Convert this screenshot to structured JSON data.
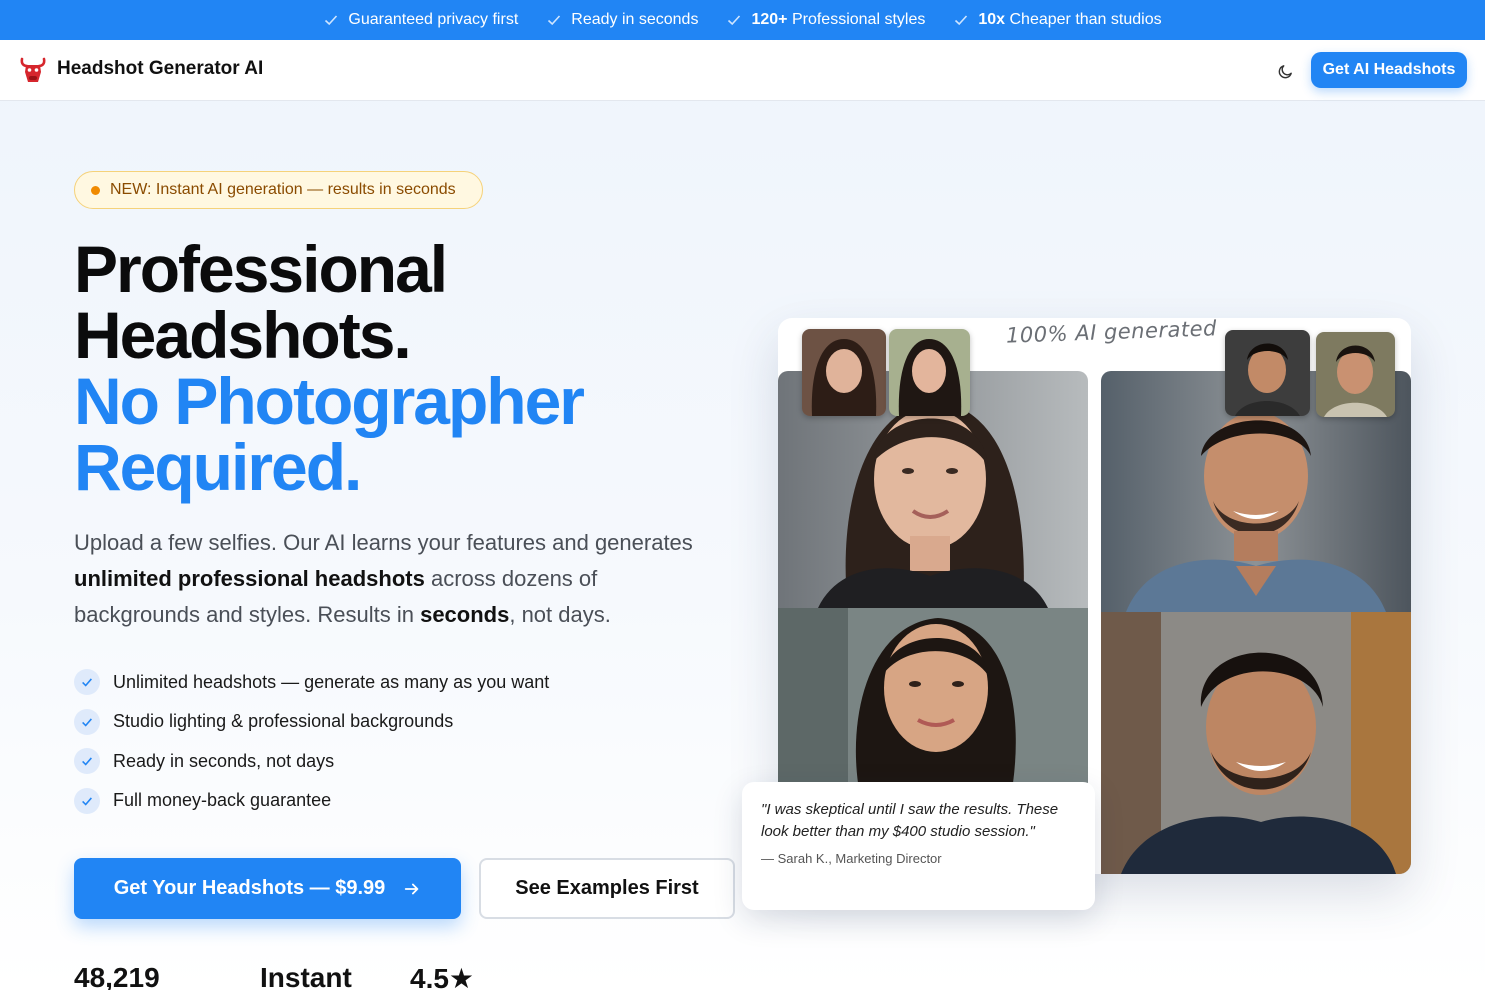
{
  "topbar": {
    "items": [
      {
        "bold": "",
        "text": "Guaranteed privacy first"
      },
      {
        "bold": "",
        "text": "Ready in seconds"
      },
      {
        "bold": "120+",
        "text": " Professional styles"
      },
      {
        "bold": "10x",
        "text": " Cheaper than studios"
      }
    ],
    "icon": "check-icon"
  },
  "navbar": {
    "brand": "Headshot Generator AI",
    "logo_icon": "bull-logo-icon",
    "theme_icon": "moon-icon",
    "cta_label": "Get AI Headshots"
  },
  "hero": {
    "badge": "NEW: Instant AI generation — results in seconds",
    "headline_dark_1": "Professional",
    "headline_dark_2": "Headshots.",
    "headline_blue_1": "No Photographer",
    "headline_blue_2": "Required.",
    "sub_1": "Upload a few selfies. Our AI learns your features and generates ",
    "sub_bold_1": "unlimited professional headshots",
    "sub_2": " across dozens of backgrounds and styles. Results in ",
    "sub_bold_2": "seconds",
    "sub_3": ", not days.",
    "features": [
      "Unlimited headshots — generate as many as you want",
      "Studio lighting & professional backgrounds",
      "Ready in seconds, not days",
      "Full money-back guarantee"
    ],
    "cta_primary": "Get Your Headshots — $9.99",
    "cta_secondary": "See Examples First",
    "stats": [
      "48,219",
      "Instant",
      "4.5★"
    ]
  },
  "gallery": {
    "label": "100% AI generated",
    "testimonial_quote": "\"I was skeptical until I saw the results. These look better than my $400 studio session.\"",
    "testimonial_author": "— Sarah K., Marketing Director"
  },
  "colors": {
    "accent": "#2185f4",
    "badge_bg": "#fff8e1",
    "badge_text": "#8a4b00"
  }
}
